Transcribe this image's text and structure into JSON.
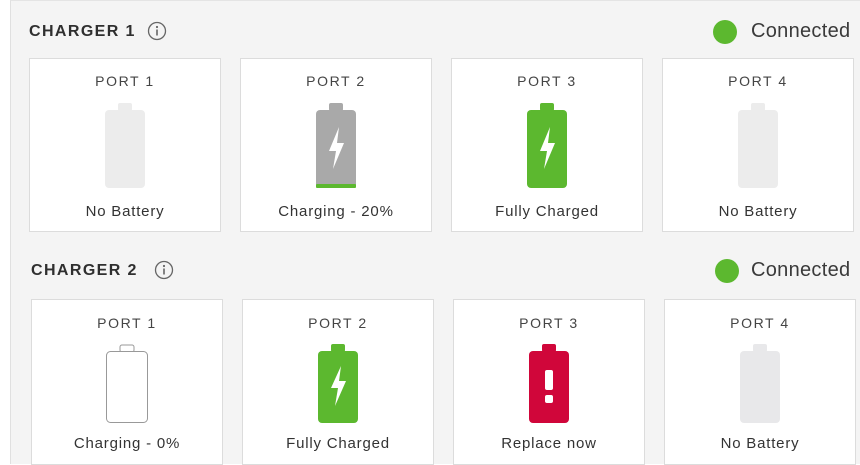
{
  "chargers": [
    {
      "title": "CHARGER 1",
      "status": "Connected",
      "status_color": "#5cb82f",
      "ports": [
        {
          "label": "PORT 1",
          "status": "No Battery",
          "state": "empty"
        },
        {
          "label": "PORT 2",
          "status": "Charging - 20%",
          "state": "charging",
          "charge_percent": 20
        },
        {
          "label": "PORT 3",
          "status": "Fully Charged",
          "state": "full"
        },
        {
          "label": "PORT 4",
          "status": "No Battery",
          "state": "empty"
        }
      ]
    },
    {
      "title": "CHARGER 2",
      "status": "Connected",
      "status_color": "#5cb82f",
      "ports": [
        {
          "label": "PORT 1",
          "status": "Charging - 0%",
          "state": "charging",
          "charge_percent": 0
        },
        {
          "label": "PORT 2",
          "status": "Fully Charged",
          "state": "full"
        },
        {
          "label": "PORT 3",
          "status": "Replace now",
          "state": "error"
        },
        {
          "label": "PORT 4",
          "status": "No Battery",
          "state": "empty"
        }
      ]
    }
  ],
  "colors": {
    "green": "#5cb82f",
    "red": "#d0063a",
    "gray_charging": "#a9a9a9",
    "empty_battery": "#ececec"
  },
  "icons": {
    "info": "info-circle-icon",
    "battery": "battery-icon",
    "bolt": "lightning-bolt-icon",
    "alert": "exclamation-icon"
  }
}
